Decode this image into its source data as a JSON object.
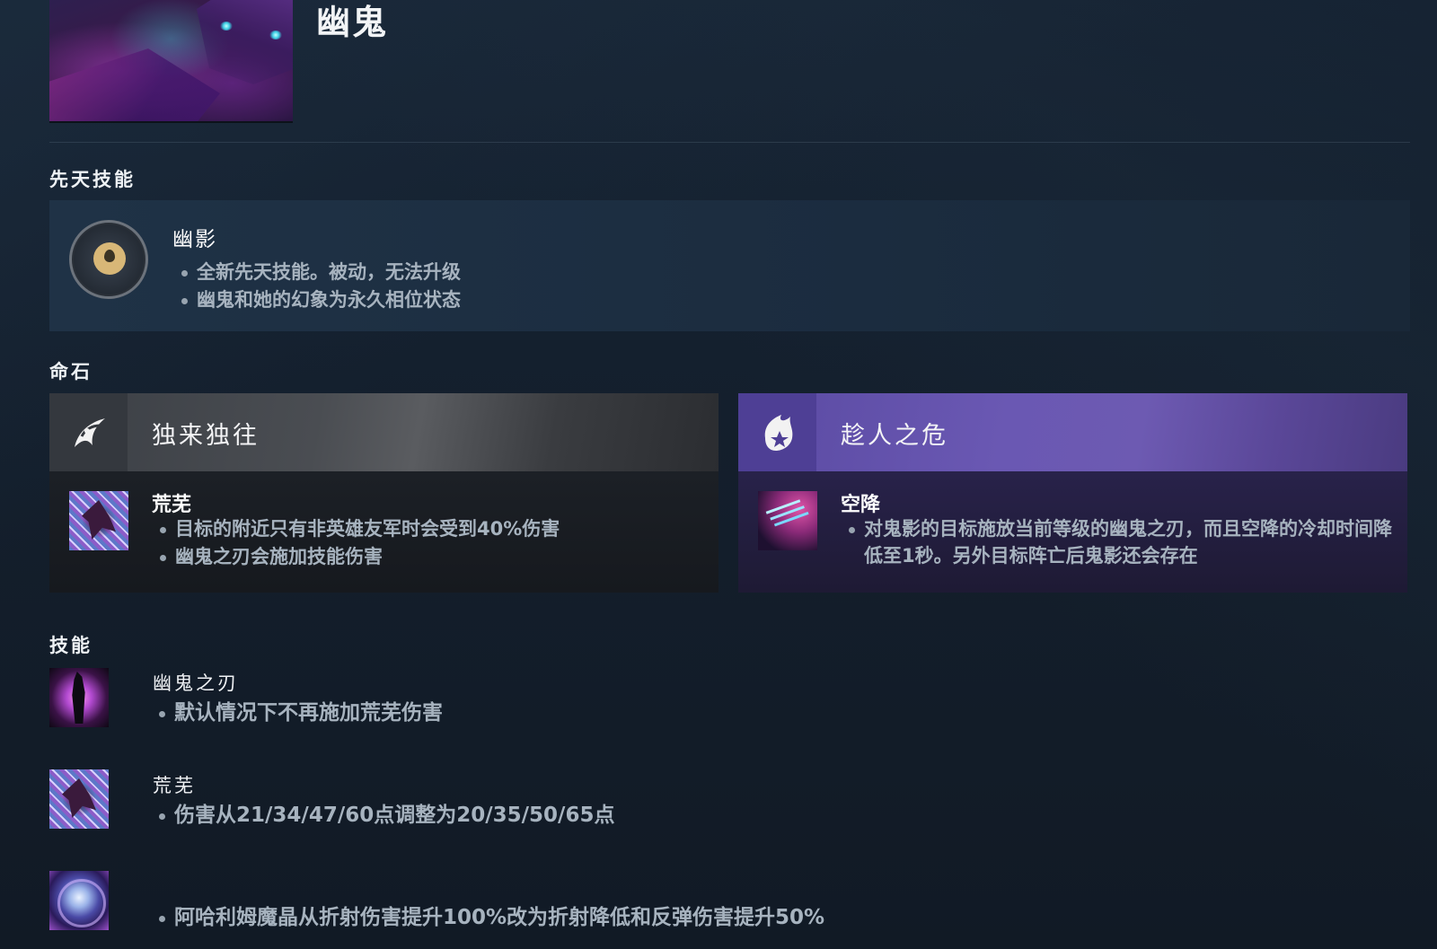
{
  "hero": {
    "name": "幽鬼"
  },
  "sections": {
    "innate_title": "先天技能",
    "facets_title": "命石",
    "abilities_title": "技能"
  },
  "innate": {
    "name": "幽影",
    "icon": "drop-icon",
    "notes": [
      "全新先天技能。被动，无法升级",
      "幽鬼和她的幻象为永久相位状态"
    ]
  },
  "facets": [
    {
      "title": "独来独往",
      "glyph": "crescent-swirl-icon",
      "ability_name": "荒芜",
      "ability_icon": "desolate-icon",
      "notes": [
        "目标的附近只有非英雄友军时会受到40%伤害",
        "幽鬼之刃会施加技能伤害"
      ]
    },
    {
      "title": "趁人之危",
      "glyph": "star-flame-icon",
      "ability_name": "空降",
      "ability_icon": "dispersion-icon",
      "notes": [
        "对鬼影的目标施放当前等级的幽鬼之刃，而且空降的冷却时间降低至1秒。另外目标阵亡后鬼影还会存在"
      ]
    }
  ],
  "abilities": [
    {
      "name": "幽鬼之刃",
      "icon": "spectral-dagger-icon",
      "notes": [
        "默认情况下不再施加荒芜伤害"
      ]
    },
    {
      "name": "荒芜",
      "icon": "desolate-icon",
      "notes": [
        "伤害从21/34/47/60点调整为20/35/50/65点"
      ]
    },
    {
      "name": "",
      "icon": "aghanims-orb-icon",
      "notes": [
        "阿哈利姆魔晶从折射伤害提升100%改为折射降低和反弹伤害提升50%"
      ]
    }
  ]
}
